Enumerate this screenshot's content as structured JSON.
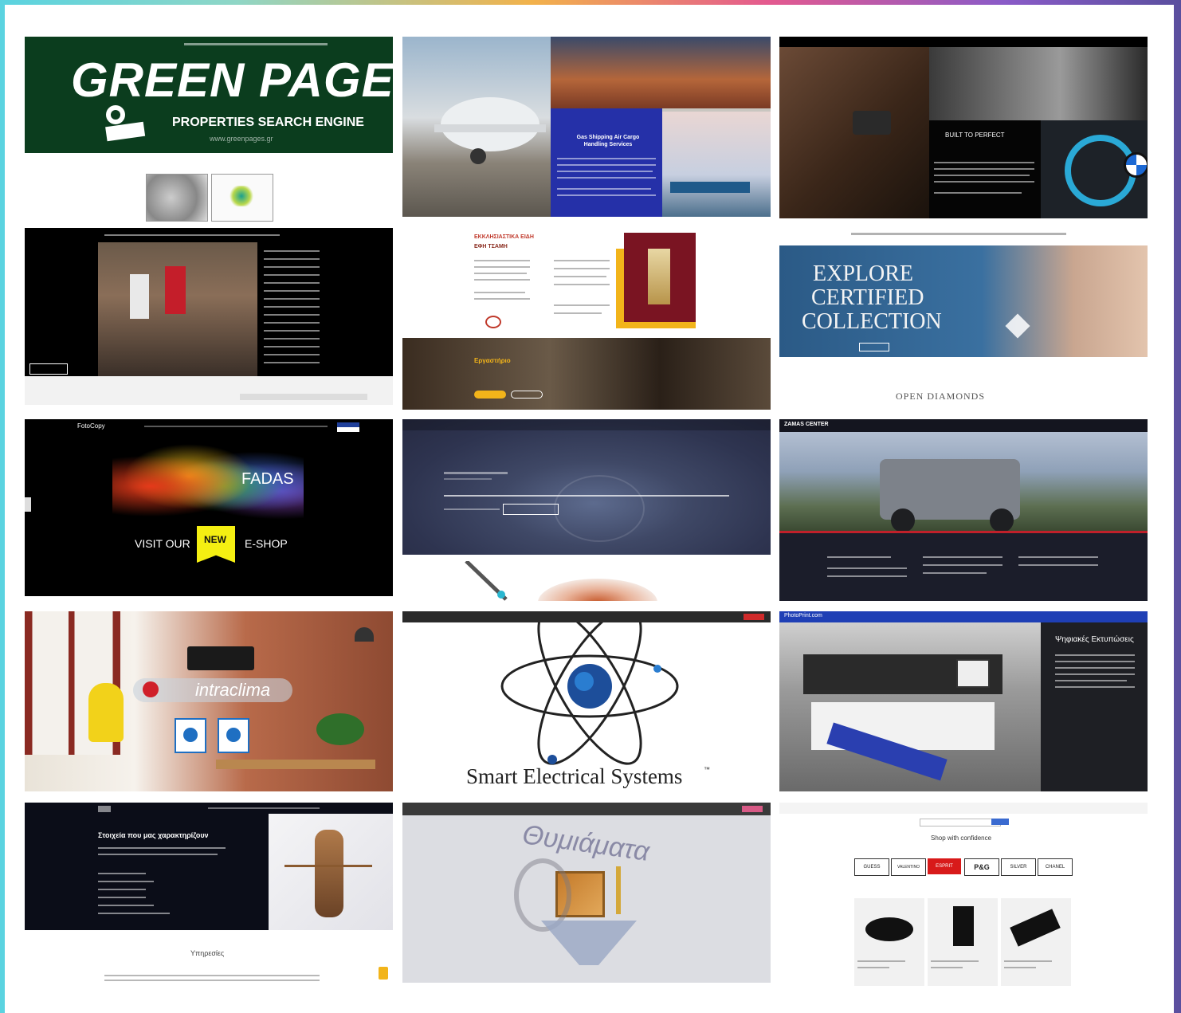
{
  "gallery": {
    "green_pages": {
      "title": "GREEN PAGES !",
      "subtitle": "PROPERTIES SEARCH ENGINE",
      "url": "www.greenpages.gr"
    },
    "shipping": {
      "heading": "Gas Shipping Air Cargo Handling Services"
    },
    "car_interior": {
      "tagline": "BUILT TO PERFECT"
    },
    "greek_church": {
      "heading": "ΕΚΚΛΗΣΙΑΣΤΙΚΑ ΕΙΔΗ",
      "subheading": "ΕΦΗ ΤΣΑΜΗ",
      "banner": "Εργαστήριο"
    },
    "diamonds": {
      "hero_line1": "EXPLORE",
      "hero_line2": "CERTIFIED",
      "hero_line3": "COLLECTION",
      "logo": "OPEN DIAMONDS"
    },
    "fotocopy": {
      "brand": "FotoCopy",
      "name": "FADAS",
      "visit": "VISIT OUR",
      "badge": "NEW",
      "shop": "E-SHOP"
    },
    "jeep": {
      "title": "ZAMAS CENTER"
    },
    "intraclima": {
      "brand": "intraclima"
    },
    "smart_electrical": {
      "title": "Smart Electrical Systems",
      "tm": "™"
    },
    "printing": {
      "brand": "PhotoPrint.com",
      "heading": "Ψηφιακές Εκτυπώσεις"
    },
    "law": {
      "heading": "Στοιχεία που μας χαρακτηρίζουν",
      "section": "Υπηρεσίες"
    },
    "sketch": {
      "word": "Θυμιάματα"
    },
    "shop": {
      "heading": "Shop with confidence",
      "brands": [
        "GUESS",
        "VALENTINO",
        "ESPRIT",
        "P&G",
        "SILVER",
        "CHANEL"
      ]
    }
  },
  "colors": {
    "green": "#0b3d1e",
    "navy": "#2530a8",
    "black": "#050505",
    "diamond_blue": "#2b5a86",
    "neon_yellow": "#f5ef12"
  }
}
